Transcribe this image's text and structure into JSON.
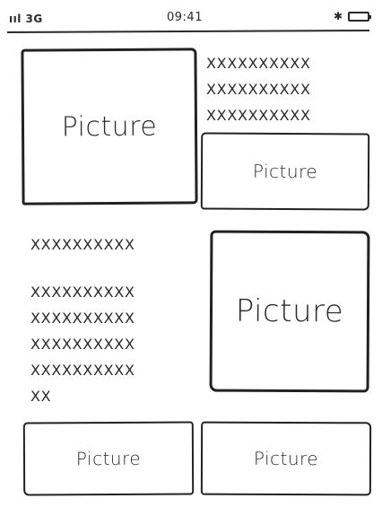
{
  "status_bar": {
    "signal": "ııl 3G",
    "time": "09:41",
    "bluetooth_glyph": "✱",
    "icons": [
      "signal-icon",
      "bluetooth-icon",
      "battery-icon"
    ]
  },
  "grid": {
    "tile_1": {
      "label": "Picture"
    },
    "text_1": {
      "lines": [
        "XXXXXXXXXX",
        "XXXXXXXXXX",
        "XXXXXXXXXX"
      ]
    },
    "tile_2": {
      "label": "Picture"
    },
    "text_2": {
      "lines": [
        "XXXXXXXXXX",
        "XXXXXXXXXX",
        "XXXXXXXXXX",
        "XXXXXXXXXX",
        "XXXXXXXXXX",
        "XX"
      ]
    },
    "tile_3": {
      "label": "Picture"
    },
    "tile_4": {
      "label": "Picture"
    },
    "tile_5": {
      "label": "Picture"
    }
  },
  "colors": {
    "ink": "#2a2a2a",
    "background": "#ffffff"
  }
}
